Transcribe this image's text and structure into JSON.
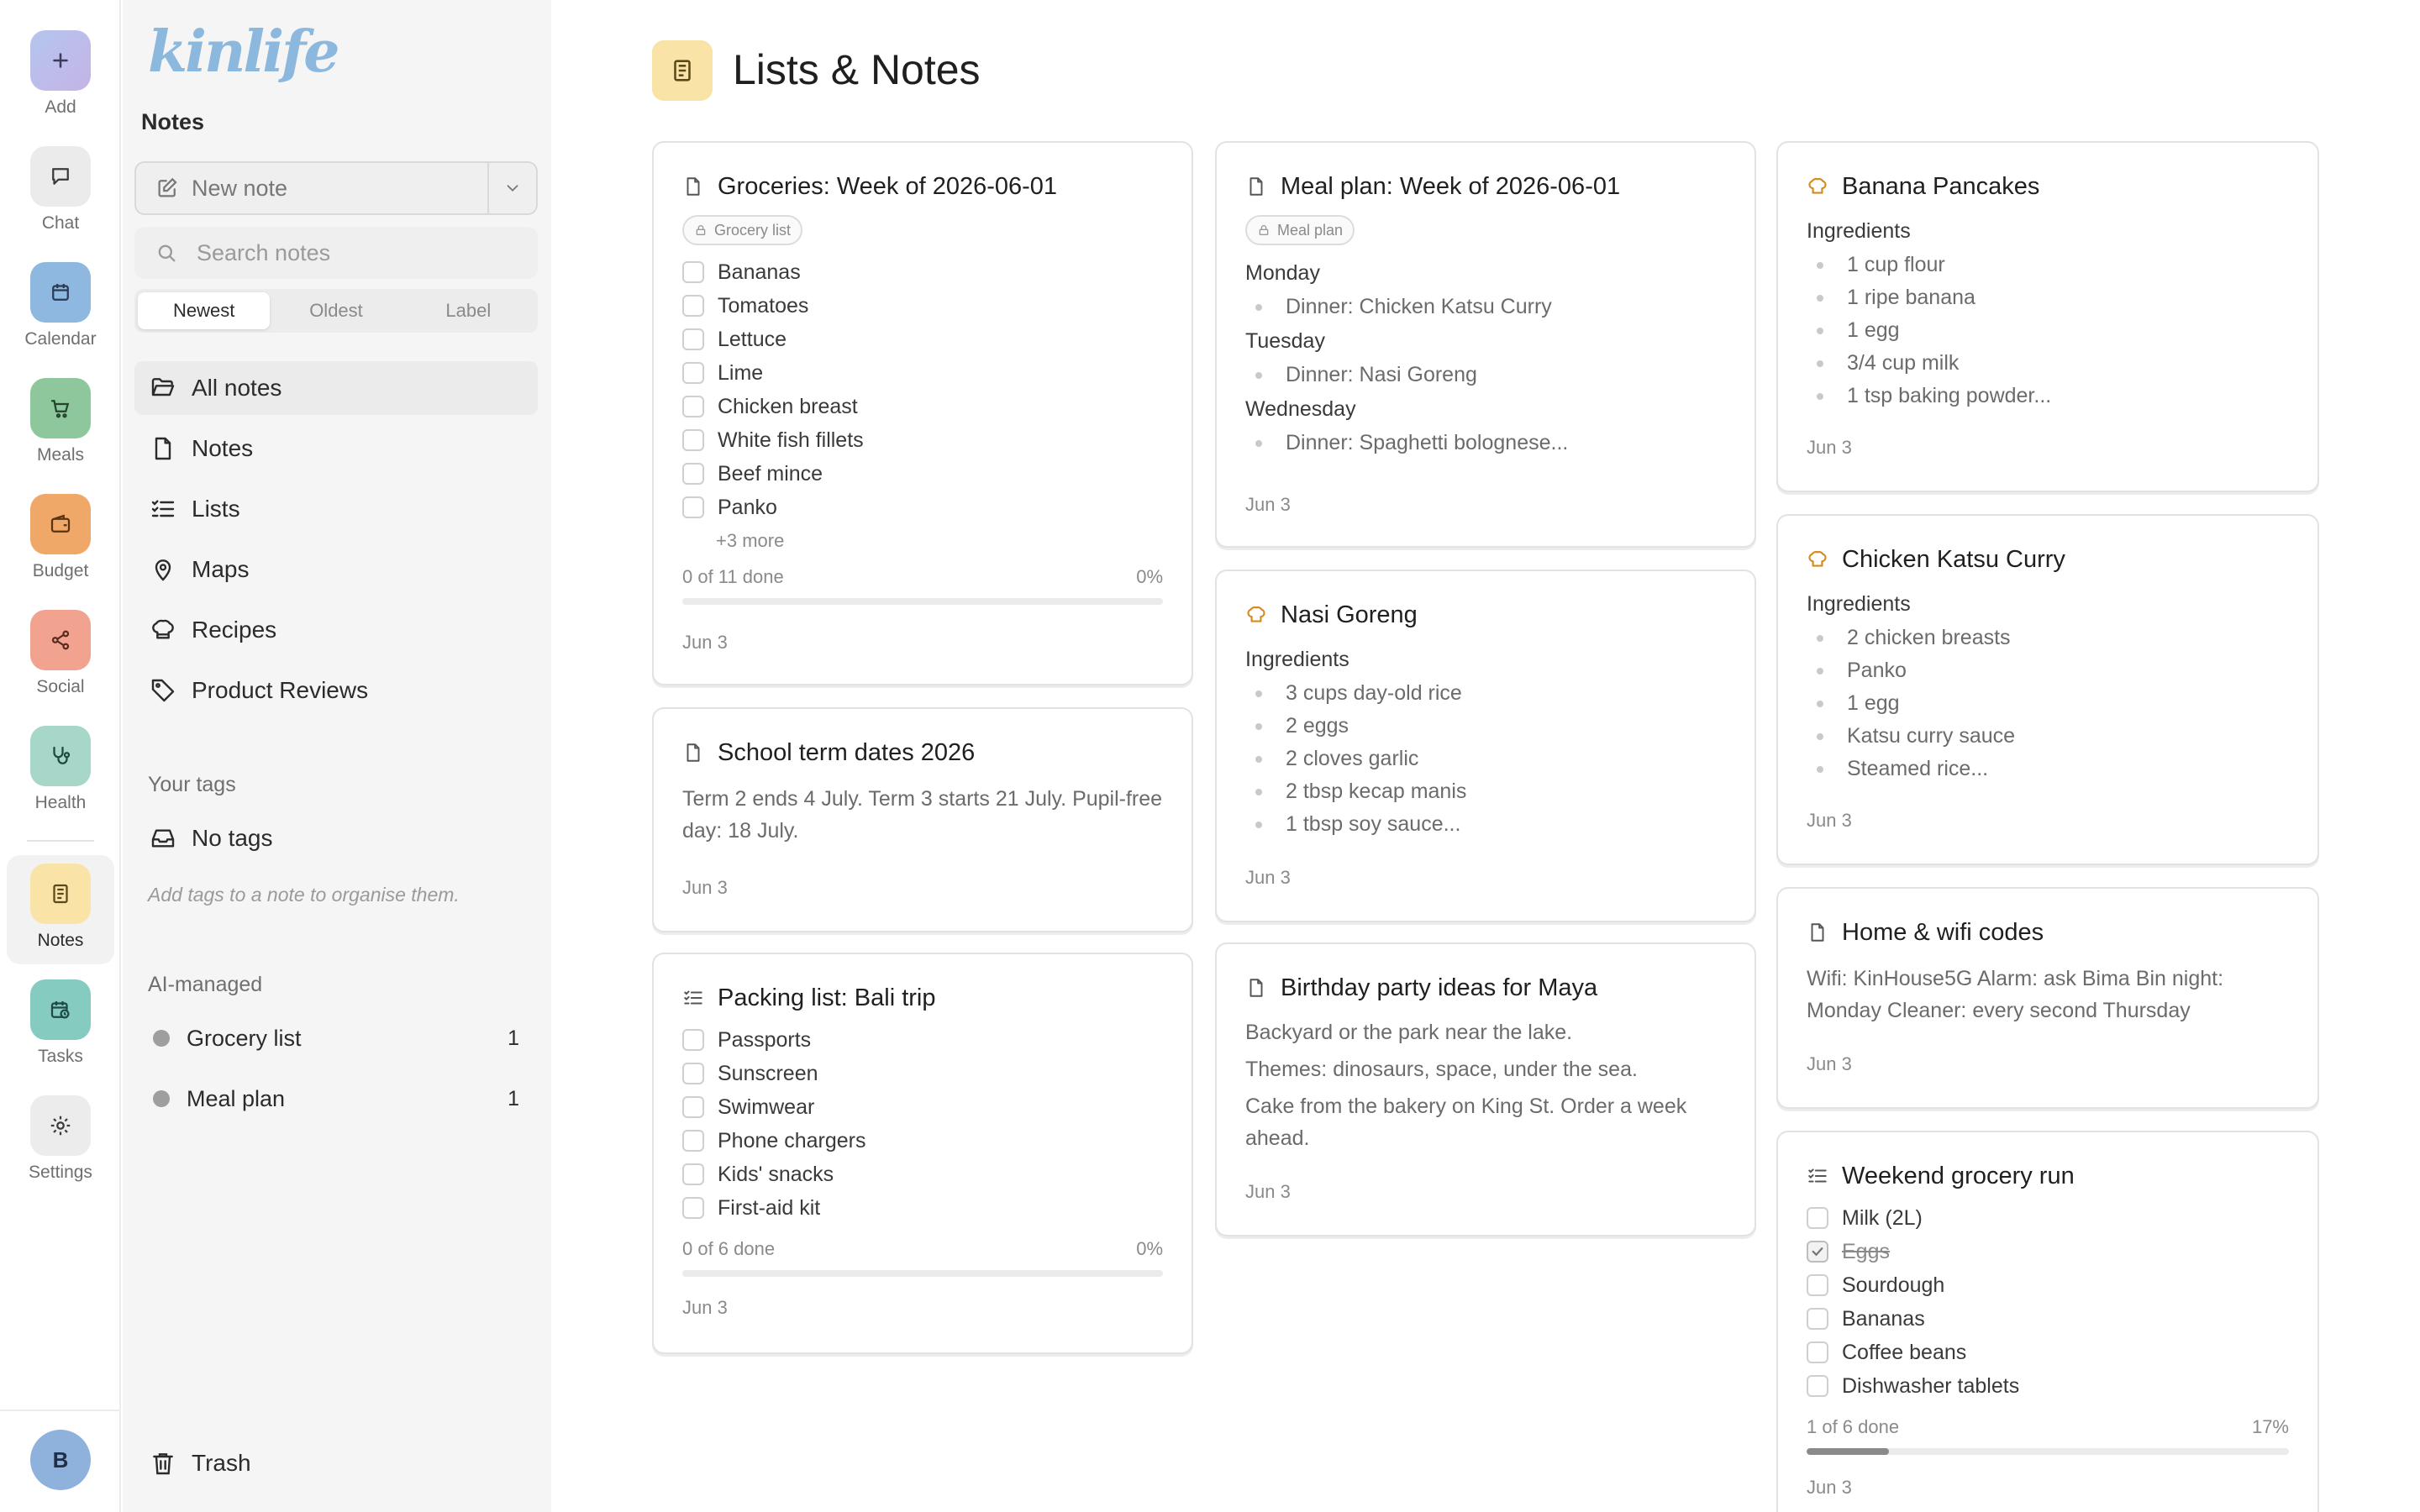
{
  "rail": {
    "items": [
      {
        "label": "Add",
        "icon": "plus-icon",
        "color": "#b9b4e6"
      },
      {
        "label": "Chat",
        "icon": "chat-icon",
        "color": "#e8e8e8"
      },
      {
        "label": "Calendar",
        "icon": "calendar-icon",
        "color": "#8eb8e0"
      },
      {
        "label": "Meals",
        "icon": "cart-icon",
        "color": "#8ec79c"
      },
      {
        "label": "Budget",
        "icon": "wallet-icon",
        "color": "#f0a868"
      },
      {
        "label": "Social",
        "icon": "share-icon",
        "color": "#f1a38f"
      },
      {
        "label": "Health",
        "icon": "stethoscope-icon",
        "color": "#9fd2c3"
      },
      {
        "label": "Notes",
        "icon": "notebook-icon",
        "color": "#fae3a7"
      },
      {
        "label": "Tasks",
        "icon": "calendar-clock-icon",
        "color": "#86cbc0"
      },
      {
        "label": "Settings",
        "icon": "gear-icon",
        "color": "#ececec"
      }
    ],
    "avatar": "B"
  },
  "sidebar": {
    "logo": "kinlife",
    "title": "Notes",
    "new_note": "New note",
    "search_placeholder": "Search notes",
    "sort": [
      "Newest",
      "Oldest",
      "Label"
    ],
    "nav": [
      {
        "label": "All notes",
        "icon": "folder-open-icon"
      },
      {
        "label": "Notes",
        "icon": "file-icon"
      },
      {
        "label": "Lists",
        "icon": "list-checks-icon"
      },
      {
        "label": "Maps",
        "icon": "map-pin-icon"
      },
      {
        "label": "Recipes",
        "icon": "chef-hat-icon"
      },
      {
        "label": "Product Reviews",
        "icon": "tag-icon"
      }
    ],
    "tags_heading": "Your tags",
    "no_tags": "No tags",
    "tags_hint": "Add tags to a note to organise them.",
    "ai_heading": "AI-managed",
    "ai_items": [
      {
        "label": "Grocery list",
        "count": "1"
      },
      {
        "label": "Meal plan",
        "count": "1"
      }
    ],
    "trash": "Trash"
  },
  "main": {
    "title": "Lists & Notes",
    "groceries": {
      "title": "Groceries: Week of 2026-06-01",
      "pill": "Grocery list",
      "items": [
        "Bananas",
        "Tomatoes",
        "Lettuce",
        "Lime",
        "Chicken breast",
        "White fish fillets",
        "Beef mince",
        "Panko"
      ],
      "more": "+3 more",
      "progress_text": "0 of 11 done",
      "progress_pct": "0%",
      "progress": 0,
      "date": "Jun 3"
    },
    "school": {
      "title": "School term dates 2026",
      "body": "Term 2 ends 4 July. Term 3 starts 21 July. Pupil-free day: 18 July.",
      "date": "Jun 3"
    },
    "packing": {
      "title": "Packing list: Bali trip",
      "items": [
        "Passports",
        "Sunscreen",
        "Swimwear",
        "Phone chargers",
        "Kids' snacks",
        "First-aid kit"
      ],
      "progress_text": "0 of 6 done",
      "progress_pct": "0%",
      "progress": 0,
      "date": "Jun 3"
    },
    "mealplan": {
      "title": "Meal plan: Week of 2026-06-01",
      "pill": "Meal plan",
      "days": [
        {
          "day": "Monday",
          "item": "Dinner: Chicken Katsu Curry"
        },
        {
          "day": "Tuesday",
          "item": "Dinner: Nasi Goreng"
        },
        {
          "day": "Wednesday",
          "item": "Dinner: Spaghetti bolognese..."
        }
      ],
      "date": "Jun 3"
    },
    "nasi": {
      "title": "Nasi Goreng",
      "sub": "Ingredients",
      "items": [
        "3 cups day-old rice",
        "2 eggs",
        "2 cloves garlic",
        "2 tbsp kecap manis",
        "1 tbsp soy sauce..."
      ],
      "date": "Jun 3"
    },
    "birthday": {
      "title": "Birthday party ideas for Maya",
      "lines": [
        "Backyard or the park near the lake.",
        "Themes: dinosaurs, space, under the sea.",
        "Cake from the bakery on King St. Order a week ahead."
      ],
      "date": "Jun 3"
    },
    "pancakes": {
      "title": "Banana Pancakes",
      "sub": "Ingredients",
      "items": [
        "1 cup flour",
        "1 ripe banana",
        "1 egg",
        "3/4 cup milk",
        "1 tsp baking powder..."
      ],
      "date": "Jun 3"
    },
    "katsu": {
      "title": "Chicken Katsu Curry",
      "sub": "Ingredients",
      "items": [
        "2 chicken breasts",
        "Panko",
        "1 egg",
        "Katsu curry sauce",
        "Steamed rice..."
      ],
      "date": "Jun 3"
    },
    "wifi": {
      "title": "Home & wifi codes",
      "body": "Wifi: KinHouse5G Alarm: ask Bima Bin night: Monday Cleaner: every second Thursday",
      "date": "Jun 3"
    },
    "weekend": {
      "title": "Weekend grocery run",
      "items": [
        {
          "label": "Milk (2L)",
          "done": false
        },
        {
          "label": "Eggs",
          "done": true
        },
        {
          "label": "Sourdough",
          "done": false
        },
        {
          "label": "Bananas",
          "done": false
        },
        {
          "label": "Coffee beans",
          "done": false
        },
        {
          "label": "Dishwasher tablets",
          "done": false
        }
      ],
      "progress_text": "1 of 6 done",
      "progress_pct": "17%",
      "progress": 0.17,
      "date": "Jun 3"
    }
  }
}
